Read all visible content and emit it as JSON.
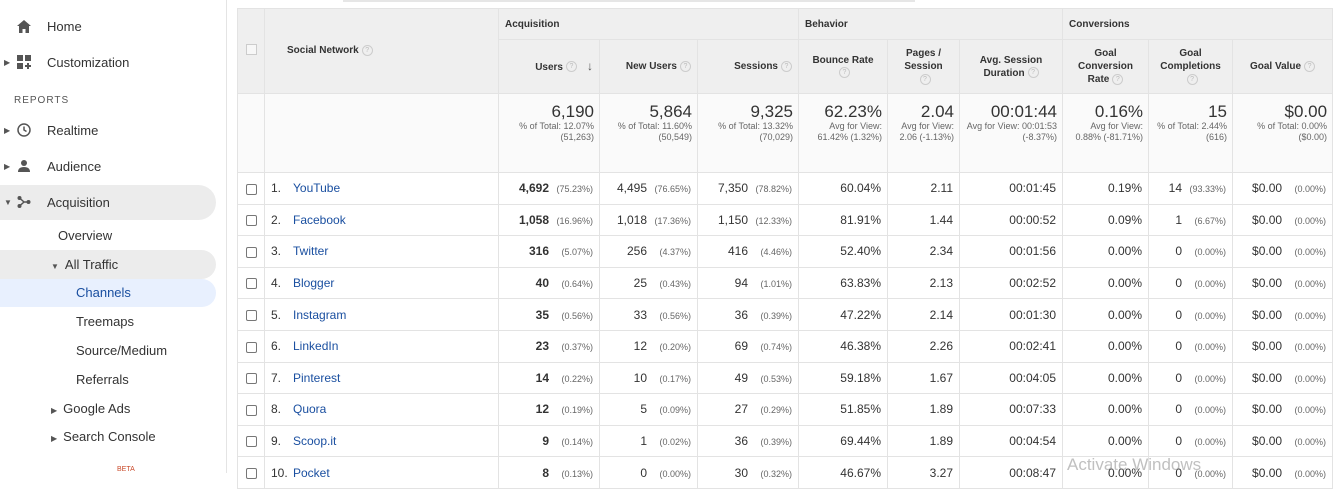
{
  "sidebar": {
    "home": "Home",
    "customization": "Customization",
    "reports_heading": "REPORTS",
    "realtime": "Realtime",
    "audience": "Audience",
    "acquisition": "Acquisition",
    "overview": "Overview",
    "all_traffic": "All Traffic",
    "channels": "Channels",
    "treemaps": "Treemaps",
    "source_medium": "Source/Medium",
    "referrals": "Referrals",
    "google_ads": "Google Ads",
    "search_console": "Search Console",
    "beta": "BETA",
    "active_color": "#e8f0fe",
    "group_color": "#ececec"
  },
  "table": {
    "groups": {
      "acquisition": "Acquisition",
      "behavior": "Behavior",
      "conversions": "Conversions"
    },
    "columns": {
      "social_network": "Social Network",
      "users": "Users",
      "new_users": "New Users",
      "sessions": "Sessions",
      "bounce_rate": "Bounce Rate",
      "pages_session_1": "Pages /",
      "pages_session_2": "Session",
      "avg_dur_1": "Avg. Session",
      "avg_dur_2": "Duration",
      "goal_conv_1": "Goal",
      "goal_conv_2": "Conversion",
      "goal_conv_3": "Rate",
      "goal_comp_1": "Goal",
      "goal_comp_2": "Completions",
      "goal_value": "Goal Value"
    },
    "totals": {
      "users": "6,190",
      "users_sub": "% of Total: 12.07% (51,263)",
      "new_users": "5,864",
      "new_users_sub": "% of Total: 11.60% (50,549)",
      "sessions": "9,325",
      "sessions_sub": "% of Total: 13.32% (70,029)",
      "bounce_rate": "62.23%",
      "bounce_rate_sub": "Avg for View: 61.42% (1.32%)",
      "pages": "2.04",
      "pages_sub": "Avg for View: 2.06 (-1.13%)",
      "duration": "00:01:44",
      "duration_sub": "Avg for View: 00:01:53 (-8.37%)",
      "goal_rate": "0.16%",
      "goal_rate_sub": "Avg for View: 0.88% (-81.71%)",
      "goal_comp": "15",
      "goal_comp_sub": "% of Total: 2.44% (616)",
      "goal_value": "$0.00",
      "goal_value_sub": "% of Total: 0.00% ($0.00)"
    },
    "rows": [
      {
        "idx": "1.",
        "name": "YouTube",
        "users": "4,692",
        "users_pct": "(75.23%)",
        "new": "4,495",
        "new_pct": "(76.65%)",
        "sess": "7,350",
        "sess_pct": "(78.82%)",
        "bounce": "60.04%",
        "pages": "2.11",
        "dur": "00:01:45",
        "rate": "0.19%",
        "comp": "14",
        "comp_pct": "(93.33%)",
        "value": "$0.00",
        "value_pct": "(0.00%)"
      },
      {
        "idx": "2.",
        "name": "Facebook",
        "users": "1,058",
        "users_pct": "(16.96%)",
        "new": "1,018",
        "new_pct": "(17.36%)",
        "sess": "1,150",
        "sess_pct": "(12.33%)",
        "bounce": "81.91%",
        "pages": "1.44",
        "dur": "00:00:52",
        "rate": "0.09%",
        "comp": "1",
        "comp_pct": "(6.67%)",
        "value": "$0.00",
        "value_pct": "(0.00%)"
      },
      {
        "idx": "3.",
        "name": "Twitter",
        "users": "316",
        "users_pct": "(5.07%)",
        "new": "256",
        "new_pct": "(4.37%)",
        "sess": "416",
        "sess_pct": "(4.46%)",
        "bounce": "52.40%",
        "pages": "2.34",
        "dur": "00:01:56",
        "rate": "0.00%",
        "comp": "0",
        "comp_pct": "(0.00%)",
        "value": "$0.00",
        "value_pct": "(0.00%)"
      },
      {
        "idx": "4.",
        "name": "Blogger",
        "users": "40",
        "users_pct": "(0.64%)",
        "new": "25",
        "new_pct": "(0.43%)",
        "sess": "94",
        "sess_pct": "(1.01%)",
        "bounce": "63.83%",
        "pages": "2.13",
        "dur": "00:02:52",
        "rate": "0.00%",
        "comp": "0",
        "comp_pct": "(0.00%)",
        "value": "$0.00",
        "value_pct": "(0.00%)"
      },
      {
        "idx": "5.",
        "name": "Instagram",
        "users": "35",
        "users_pct": "(0.56%)",
        "new": "33",
        "new_pct": "(0.56%)",
        "sess": "36",
        "sess_pct": "(0.39%)",
        "bounce": "47.22%",
        "pages": "2.14",
        "dur": "00:01:30",
        "rate": "0.00%",
        "comp": "0",
        "comp_pct": "(0.00%)",
        "value": "$0.00",
        "value_pct": "(0.00%)"
      },
      {
        "idx": "6.",
        "name": "LinkedIn",
        "users": "23",
        "users_pct": "(0.37%)",
        "new": "12",
        "new_pct": "(0.20%)",
        "sess": "69",
        "sess_pct": "(0.74%)",
        "bounce": "46.38%",
        "pages": "2.26",
        "dur": "00:02:41",
        "rate": "0.00%",
        "comp": "0",
        "comp_pct": "(0.00%)",
        "value": "$0.00",
        "value_pct": "(0.00%)"
      },
      {
        "idx": "7.",
        "name": "Pinterest",
        "users": "14",
        "users_pct": "(0.22%)",
        "new": "10",
        "new_pct": "(0.17%)",
        "sess": "49",
        "sess_pct": "(0.53%)",
        "bounce": "59.18%",
        "pages": "1.67",
        "dur": "00:04:05",
        "rate": "0.00%",
        "comp": "0",
        "comp_pct": "(0.00%)",
        "value": "$0.00",
        "value_pct": "(0.00%)"
      },
      {
        "idx": "8.",
        "name": "Quora",
        "users": "12",
        "users_pct": "(0.19%)",
        "new": "5",
        "new_pct": "(0.09%)",
        "sess": "27",
        "sess_pct": "(0.29%)",
        "bounce": "51.85%",
        "pages": "1.89",
        "dur": "00:07:33",
        "rate": "0.00%",
        "comp": "0",
        "comp_pct": "(0.00%)",
        "value": "$0.00",
        "value_pct": "(0.00%)"
      },
      {
        "idx": "9.",
        "name": "Scoop.it",
        "users": "9",
        "users_pct": "(0.14%)",
        "new": "1",
        "new_pct": "(0.02%)",
        "sess": "36",
        "sess_pct": "(0.39%)",
        "bounce": "69.44%",
        "pages": "1.89",
        "dur": "00:04:54",
        "rate": "0.00%",
        "comp": "0",
        "comp_pct": "(0.00%)",
        "value": "$0.00",
        "value_pct": "(0.00%)"
      },
      {
        "idx": "10.",
        "name": "Pocket",
        "users": "8",
        "users_pct": "(0.13%)",
        "new": "0",
        "new_pct": "(0.00%)",
        "sess": "30",
        "sess_pct": "(0.32%)",
        "bounce": "46.67%",
        "pages": "3.27",
        "dur": "00:08:47",
        "rate": "0.00%",
        "comp": "0",
        "comp_pct": "(0.00%)",
        "value": "$0.00",
        "value_pct": "(0.00%)"
      }
    ]
  },
  "watermark": "Activate Windows"
}
